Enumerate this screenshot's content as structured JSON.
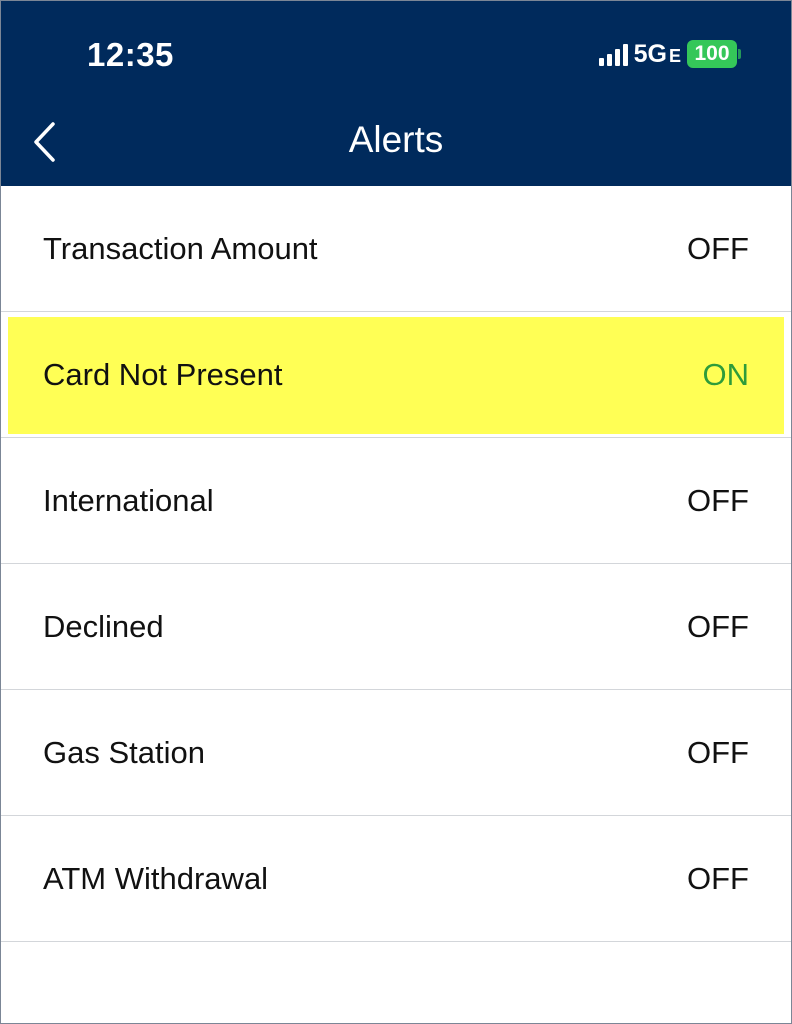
{
  "status_bar": {
    "time": "12:35",
    "network": "5G",
    "network_suffix": "E",
    "battery": "100",
    "signal_icon": "cellular-signal-icon",
    "battery_color": "#35c759"
  },
  "nav": {
    "title": "Alerts",
    "back_icon": "chevron-left-icon",
    "background": "#002a5c"
  },
  "alerts": [
    {
      "label": "Transaction Amount",
      "value": "OFF"
    },
    {
      "label": "Card Not Present",
      "value": "ON",
      "highlighted": true
    },
    {
      "label": "International",
      "value": "OFF"
    },
    {
      "label": "Declined",
      "value": "OFF"
    },
    {
      "label": "Gas Station",
      "value": "OFF"
    },
    {
      "label": "ATM Withdrawal",
      "value": "OFF"
    }
  ],
  "colors": {
    "on": "#2e9c3a",
    "off": "#111111",
    "highlight": "#ffff55"
  }
}
